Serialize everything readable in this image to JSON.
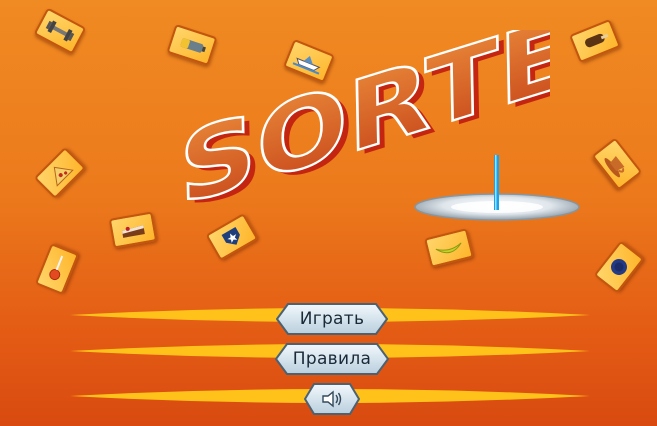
{
  "game": {
    "title": "SORTER",
    "colors": {
      "background": "#ec7a1c",
      "title_fill": "#d9621a",
      "title_outline": "#ffffff",
      "title_shadow": "#c01c10",
      "ribbon": "#ffc21a",
      "button_face": "#cfe2ee"
    },
    "icons": [
      "dumbbell-icon",
      "battery-icon",
      "boat-icon",
      "popsicle-icon",
      "pizza-icon",
      "cake-icon",
      "badge-icon",
      "banana-icon",
      "lollipop-icon",
      "cup-icon",
      "plate-icon"
    ]
  },
  "menu": {
    "play_label": "Играть",
    "rules_label": "Правила",
    "sound_icon": "speaker-icon"
  }
}
